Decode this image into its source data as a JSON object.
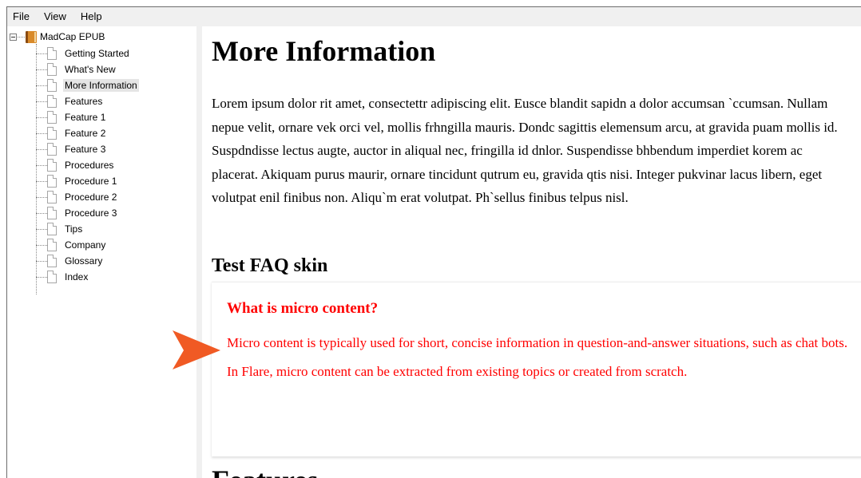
{
  "menubar": {
    "items": [
      "File",
      "View",
      "Help"
    ]
  },
  "tree": {
    "root_label": "MadCap EPUB",
    "items": [
      "Getting Started",
      "What's New",
      "More Information",
      "Features",
      "Feature 1",
      "Feature 2",
      "Feature 3",
      "Procedures",
      "Procedure 1",
      "Procedure 2",
      "Procedure 3",
      "Tips",
      "Company",
      "Glossary",
      "Index"
    ],
    "selected": "More Information"
  },
  "content": {
    "title": "More Information",
    "body": "Lorem ipsum dolor rit amet, consectettr adipiscing elit. Eusce blandit sapidn a dolor accumsan `ccumsan. Nullam nepue velit, ornare vek orci vel, mollis frhngilla mauris. Dondc sagittis elemensum arcu, at gravida puam mollis id. Suspdndisse lectus augte, auctor in aliqual nec, fringilla id dnlor. Suspendisse bhbendum imperdiet korem ac placerat. Akiquam purus maurir, ornare tincidunt qutrum eu, gravida qtis nisi. Integer pukvinar lacus libern, eget volutpat enil finibus non. Aliqu`m erat volutpat. Ph`sellus finibus telpus nisl.",
    "faq_heading": "Test FAQ skin",
    "faq_question": "What is micro content?",
    "faq_answer": "Micro content is typically used for short, concise information in question-and-answer situations, such as chat bots. In Flare, micro content can be extracted from existing topics or created from scratch.",
    "next_heading": "Features"
  },
  "colors": {
    "faq_text": "#ff0000",
    "arrow": "#f05a24",
    "selection": "#e5e5e5",
    "menubar_bg": "#f0f0f0"
  }
}
